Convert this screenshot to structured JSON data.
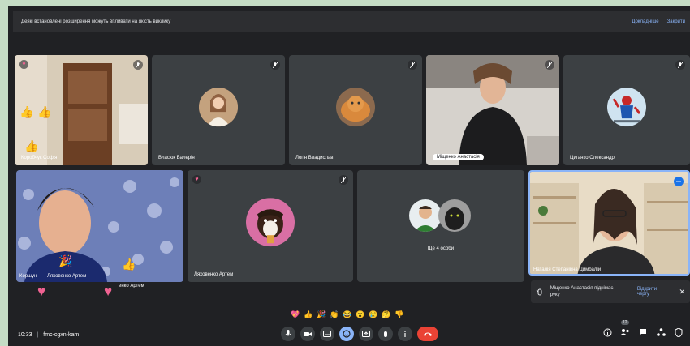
{
  "banner": {
    "text": "Деякі встановлені розширення можуть впливати на якість виклику",
    "details": "Докладніше",
    "close": "Закрити"
  },
  "participants": [
    {
      "name": "Коробчук Софія"
    },
    {
      "name": "Власюк Валерія"
    },
    {
      "name": "Логін Владислав"
    },
    {
      "name": "Міщенко Анастасія"
    },
    {
      "name": "Циганко Олександр"
    },
    {
      "name": "Ляховенко Артем"
    },
    {
      "name": "Ляховенко Артем"
    },
    {
      "name": "Ще 4 особи"
    },
    {
      "name": "Наталія Степанівна Цимбалій"
    }
  ],
  "overlay_labels": {
    "a": "Коршун",
    "b": "Ляховенко Артем",
    "c": "енко Артем"
  },
  "hand_raise": {
    "text": "Міщенко Анастасія піднімає руку",
    "action": "Відкрити чергу"
  },
  "toolbar": {
    "time": "10:33",
    "separator": "|",
    "meeting_code": "fmc-cgxn-kam",
    "participant_count": "12"
  },
  "reactions": [
    "💖",
    "👍",
    "🎉",
    "👏",
    "😂",
    "😮",
    "😢",
    "🤔",
    "👎"
  ],
  "colors": {
    "accent": "#8ab4f8",
    "hangup": "#ea4335",
    "background": "#202124",
    "tile": "#3c4043"
  }
}
